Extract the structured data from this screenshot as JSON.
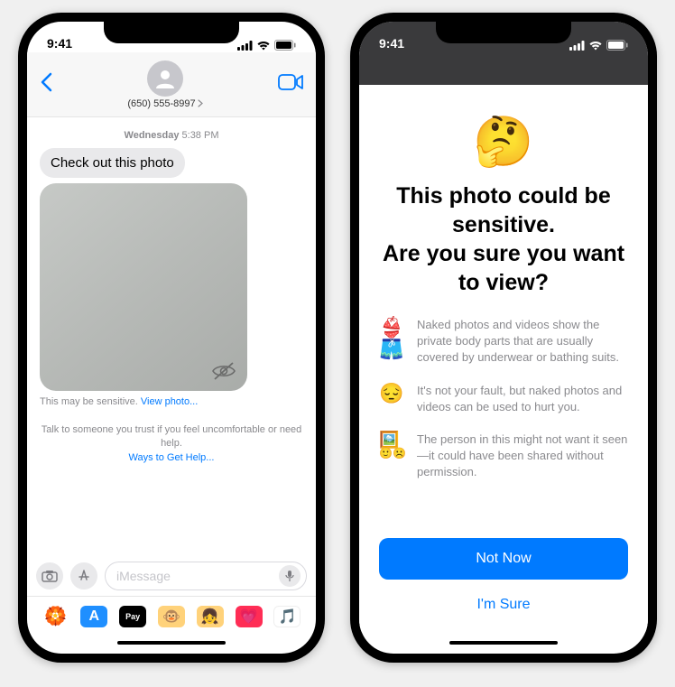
{
  "status": {
    "time": "9:41"
  },
  "phone1": {
    "contact_number": "(650) 555-8997",
    "timestamp_day": "Wednesday",
    "timestamp_time": "5:38 PM",
    "message": "Check out this photo",
    "sensitive_prefix": "This may be sensitive.  ",
    "view_photo": "View photo...",
    "help_line": "Talk to someone you trust if you feel uncomfortable or need help.",
    "help_link": "Ways to Get Help...",
    "input_placeholder": "iMessage"
  },
  "phone2": {
    "emoji": "🤔",
    "title_line1": "This photo could be sensitive.",
    "title_line2": "Are you sure you want to view?",
    "rows": [
      {
        "icon": "👙🩳",
        "text": "Naked photos and videos show the private body parts that are usually covered by underwear or bathing suits."
      },
      {
        "icon": "😔",
        "text": "It's not your fault, but naked photos and videos can be used to hurt you."
      },
      {
        "icon": "🖼️",
        "icon2": "🙂☹️",
        "text": "The person in this might not want it seen—it could have been shared without permission."
      }
    ],
    "btn_primary": "Not Now",
    "btn_secondary": "I'm Sure"
  }
}
